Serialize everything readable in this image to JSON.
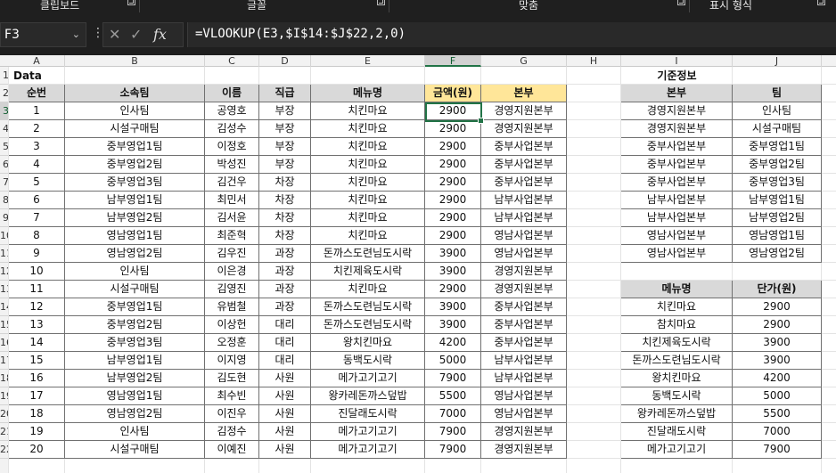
{
  "ribbon": {
    "groups": [
      {
        "label": "클립보드"
      },
      {
        "label": "글꼴"
      },
      {
        "label": "맞춤"
      },
      {
        "label": "표시 형식"
      }
    ]
  },
  "formula_bar": {
    "name_box": "F3",
    "formula": "=VLOOKUP(E3,$I$14:$J$22,2,0)",
    "cancel_icon": "✕",
    "enter_icon": "✓",
    "fx_label": "fx"
  },
  "columns": [
    "A",
    "B",
    "C",
    "D",
    "E",
    "F",
    "G",
    "H",
    "I",
    "J"
  ],
  "rows": [
    "1",
    "2",
    "3",
    "4",
    "5",
    "6",
    "7",
    "8",
    "9",
    "10",
    "11",
    "12",
    "13",
    "14",
    "15",
    "16",
    "17",
    "18",
    "19",
    "20",
    "21",
    "22"
  ],
  "active_cell": "F3",
  "main_table": {
    "caption": "Data",
    "headers": [
      "순번",
      "소속팀",
      "이름",
      "직급",
      "메뉴명",
      "금액(원)",
      "본부"
    ],
    "rows": [
      [
        "1",
        "인사팀",
        "공영호",
        "부장",
        "치킨마요",
        "2900",
        "경영지원본부"
      ],
      [
        "2",
        "시설구매팀",
        "김성수",
        "부장",
        "치킨마요",
        "2900",
        "경영지원본부"
      ],
      [
        "3",
        "중부영업1팀",
        "이정호",
        "부장",
        "치킨마요",
        "2900",
        "중부사업본부"
      ],
      [
        "4",
        "중부영업2팀",
        "박성진",
        "부장",
        "치킨마요",
        "2900",
        "중부사업본부"
      ],
      [
        "5",
        "중부영업3팀",
        "김건우",
        "차장",
        "치킨마요",
        "2900",
        "중부사업본부"
      ],
      [
        "6",
        "남부영업1팀",
        "최민서",
        "차장",
        "치킨마요",
        "2900",
        "남부사업본부"
      ],
      [
        "7",
        "남부영업2팀",
        "김서윤",
        "차장",
        "치킨마요",
        "2900",
        "남부사업본부"
      ],
      [
        "8",
        "영남영업1팀",
        "최준혁",
        "차장",
        "치킨마요",
        "2900",
        "영남사업본부"
      ],
      [
        "9",
        "영남영업2팀",
        "김우진",
        "과장",
        "돈까스도련님도시락",
        "3900",
        "영남사업본부"
      ],
      [
        "10",
        "인사팀",
        "이은경",
        "과장",
        "치킨제육도시락",
        "3900",
        "경영지원본부"
      ],
      [
        "11",
        "시설구매팀",
        "김영진",
        "과장",
        "치킨마요",
        "2900",
        "경영지원본부"
      ],
      [
        "12",
        "중부영업1팀",
        "유범철",
        "과장",
        "돈까스도련님도시락",
        "3900",
        "중부사업본부"
      ],
      [
        "13",
        "중부영업2팀",
        "이상헌",
        "대리",
        "돈까스도련님도시락",
        "3900",
        "중부사업본부"
      ],
      [
        "14",
        "중부영업3팀",
        "오정훈",
        "대리",
        "왕치킨마요",
        "4200",
        "중부사업본부"
      ],
      [
        "15",
        "남부영업1팀",
        "이지영",
        "대리",
        "동백도시락",
        "5000",
        "남부사업본부"
      ],
      [
        "16",
        "남부영업2팀",
        "김도현",
        "사원",
        "메가고기고기",
        "7900",
        "남부사업본부"
      ],
      [
        "17",
        "영남영업1팀",
        "최수빈",
        "사원",
        "왕카레돈까스덮밥",
        "5500",
        "영남사업본부"
      ],
      [
        "18",
        "영남영업2팀",
        "이진우",
        "사원",
        "진달래도시락",
        "7000",
        "영남사업본부"
      ],
      [
        "19",
        "인사팀",
        "김정수",
        "사원",
        "메가고기고기",
        "7900",
        "경영지원본부"
      ],
      [
        "20",
        "시설구매팀",
        "이예진",
        "사원",
        "메가고기고기",
        "7900",
        "경영지원본부"
      ]
    ]
  },
  "ref_title": "기준정보",
  "team_table": {
    "headers": [
      "본부",
      "팀"
    ],
    "rows": [
      [
        "경영지원본부",
        "인사팀"
      ],
      [
        "경영지원본부",
        "시설구매팀"
      ],
      [
        "중부사업본부",
        "중부영업1팀"
      ],
      [
        "중부사업본부",
        "중부영업2팀"
      ],
      [
        "중부사업본부",
        "중부영업3팀"
      ],
      [
        "남부사업본부",
        "남부영업1팀"
      ],
      [
        "남부사업본부",
        "남부영업2팀"
      ],
      [
        "영남사업본부",
        "영남영업1팀"
      ],
      [
        "영남사업본부",
        "영남영업2팀"
      ]
    ]
  },
  "price_table": {
    "headers": [
      "메뉴명",
      "단가(원)"
    ],
    "rows": [
      [
        "치킨마요",
        "2900"
      ],
      [
        "참치마요",
        "2900"
      ],
      [
        "치킨제육도시락",
        "3900"
      ],
      [
        "돈까스도련님도시락",
        "3900"
      ],
      [
        "왕치킨마요",
        "4200"
      ],
      [
        "동백도시락",
        "5000"
      ],
      [
        "왕카레돈까스덮밥",
        "5500"
      ],
      [
        "진달래도시락",
        "7000"
      ],
      [
        "메가고기고기",
        "7900"
      ]
    ]
  }
}
